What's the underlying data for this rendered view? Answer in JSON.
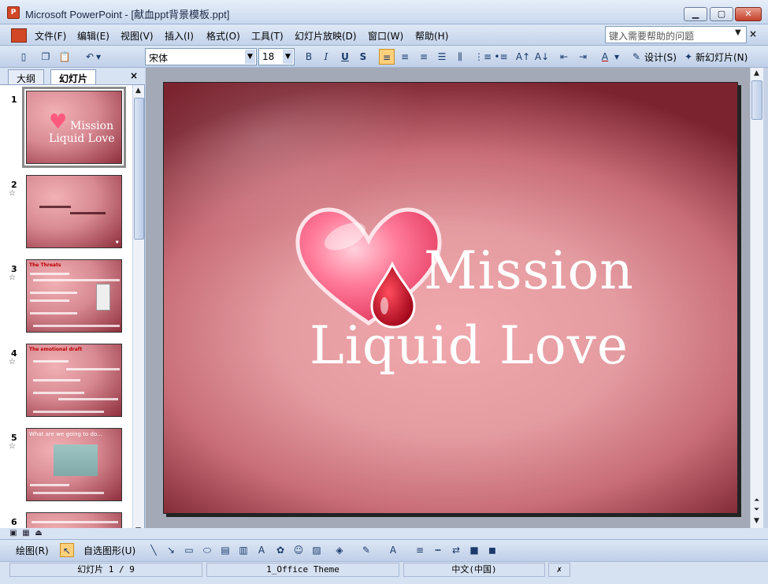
{
  "window": {
    "title": "Microsoft PowerPoint - [献血ppt背景模板.ppt]",
    "app_icon": "P"
  },
  "menu": {
    "items": [
      "文件(F)",
      "编辑(E)",
      "视图(V)",
      "插入(I)",
      "格式(O)",
      "工具(T)",
      "幻灯片放映(D)",
      "窗口(W)",
      "帮助(H)"
    ],
    "help_placeholder": "键入需要帮助的问题"
  },
  "toolbar": {
    "font_name": "宋体",
    "font_size": "18",
    "bold": "B",
    "italic": "I",
    "underline": "U",
    "shadow": "S",
    "design_label": "设计(S)",
    "new_slide_label": "新幻灯片(N)"
  },
  "left_pane": {
    "tabs": [
      "大纲",
      "幻灯片"
    ],
    "close": "×",
    "thumbnails": [
      {
        "num": "1",
        "title1": "Mission",
        "title2": "Liquid Love"
      },
      {
        "num": "2",
        "star": "☆"
      },
      {
        "num": "3",
        "star": "☆",
        "heading": "The Threats"
      },
      {
        "num": "4",
        "star": "☆",
        "heading": "The emotional draft"
      },
      {
        "num": "5",
        "star": "☆",
        "heading": "What are we going to do..."
      },
      {
        "num": "6"
      }
    ]
  },
  "slide": {
    "line1": "Mission",
    "line2": "Liquid Love"
  },
  "drawing": {
    "draw_label": "绘图(R)",
    "autoshape_label": "自选图形(U)"
  },
  "status": {
    "slide_pos": "幻灯片 1 / 9",
    "theme": "1_Office Theme",
    "language": "中文(中国)"
  },
  "colors": {
    "slide_pink": "#e49ca1",
    "slide_dark": "#7b2430",
    "heart": "#ff5a7e",
    "drop": "#c0001b"
  }
}
